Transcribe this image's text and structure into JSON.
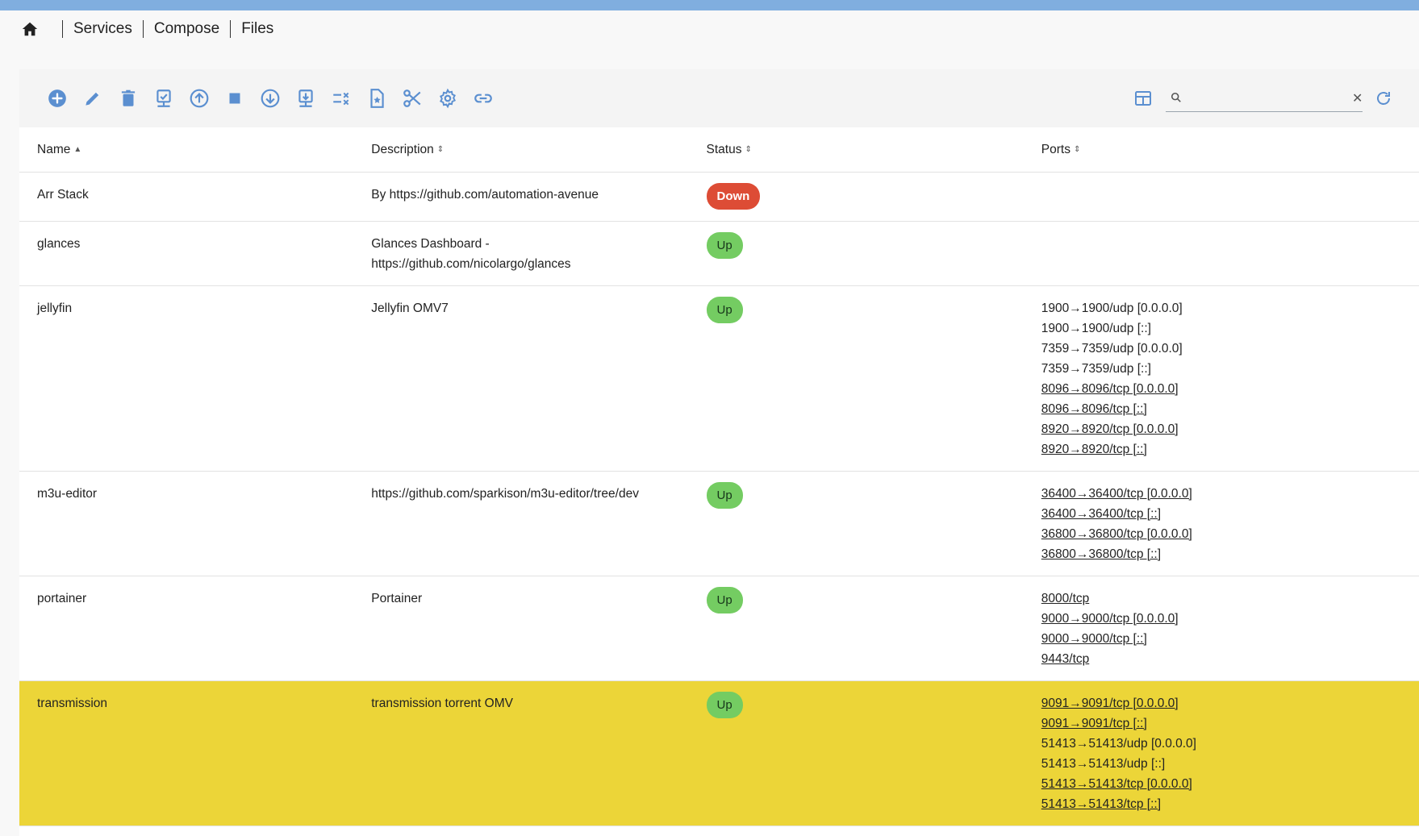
{
  "breadcrumb": {
    "items": [
      "Services",
      "Compose",
      "Files"
    ]
  },
  "toolbar": {
    "icons": [
      "add-icon",
      "edit-icon",
      "delete-icon",
      "check-icon",
      "up-icon",
      "stop-icon",
      "down-icon",
      "pull-icon",
      "clean-icon",
      "file-icon",
      "cut-icon",
      "settings-icon",
      "link-icon"
    ],
    "search_value": ""
  },
  "table": {
    "headers": [
      "Name",
      "Description",
      "Status",
      "Ports"
    ],
    "sort_column": "Name",
    "rows": [
      {
        "name": "Arr Stack",
        "description": "By https://github.com/automation-avenue",
        "status": "Down",
        "ports": []
      },
      {
        "name": "glances",
        "description": "Glances Dashboard - https://github.com/nicolargo/glances",
        "status": "Up",
        "ports": []
      },
      {
        "name": "jellyfin",
        "description": "Jellyfin OMV7",
        "status": "Up",
        "ports": [
          {
            "text": "1900→1900/udp [0.0.0.0]",
            "link": false
          },
          {
            "text": "1900→1900/udp [::]",
            "link": false
          },
          {
            "text": "7359→7359/udp [0.0.0.0]",
            "link": false
          },
          {
            "text": "7359→7359/udp [::]",
            "link": false
          },
          {
            "text": "8096→8096/tcp [0.0.0.0]",
            "link": true
          },
          {
            "text": "8096→8096/tcp [::]",
            "link": true
          },
          {
            "text": "8920→8920/tcp [0.0.0.0]",
            "link": true
          },
          {
            "text": "8920→8920/tcp [::]",
            "link": true
          }
        ]
      },
      {
        "name": "m3u-editor",
        "description": "https://github.com/sparkison/m3u-editor/tree/dev",
        "status": "Up",
        "ports": [
          {
            "text": "36400→36400/tcp [0.0.0.0]",
            "link": true
          },
          {
            "text": "36400→36400/tcp [::]",
            "link": true
          },
          {
            "text": "36800→36800/tcp [0.0.0.0]",
            "link": true
          },
          {
            "text": "36800→36800/tcp [::]",
            "link": true
          }
        ]
      },
      {
        "name": "portainer",
        "description": "Portainer",
        "status": "Up",
        "ports": [
          {
            "text": "8000/tcp",
            "link": true
          },
          {
            "text": "9000→9000/tcp [0.0.0.0]",
            "link": true
          },
          {
            "text": "9000→9000/tcp [::]",
            "link": true
          },
          {
            "text": "9443/tcp",
            "link": true
          }
        ]
      },
      {
        "name": "transmission",
        "description": "transmission torrent OMV",
        "status": "Up",
        "selected": true,
        "ports": [
          {
            "text": "9091→9091/tcp [0.0.0.0]",
            "link": true
          },
          {
            "text": "9091→9091/tcp [::]",
            "link": true
          },
          {
            "text": "51413→51413/udp [0.0.0.0]",
            "link": false
          },
          {
            "text": "51413→51413/udp [::]",
            "link": false
          },
          {
            "text": "51413→51413/tcp [0.0.0.0]",
            "link": true
          },
          {
            "text": "51413→51413/tcp [::]",
            "link": true
          }
        ]
      }
    ]
  },
  "colors": {
    "accent": "#80aedf",
    "icon": "#5b8fd0",
    "down": "#dd4c35",
    "up": "#74cc62",
    "selected_row": "#ecd538"
  }
}
